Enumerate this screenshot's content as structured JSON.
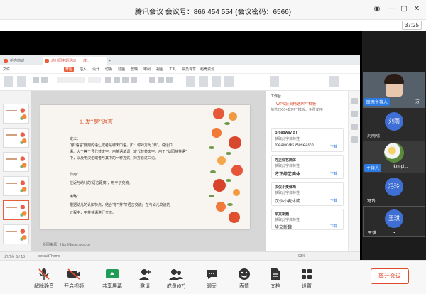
{
  "window": {
    "title": "腾讯会议  会议号：866 454 554  (会议密码：6566)",
    "timer": "37:25"
  },
  "wps": {
    "tabs": [
      "稻壳商城",
      "幼儿园主题活动一一教...",
      "+"
    ],
    "menu": [
      "文件",
      "开始",
      "插入",
      "设计",
      "切换",
      "动画",
      "放映",
      "审阅",
      "视图",
      "工具",
      "会员专享",
      "稻壳资源"
    ],
    "status": [
      "幻灯片 5 / 13",
      "defaultTheme",
      "单击此处添加备注",
      "93%"
    ],
    "thumb_numbers": [
      "1",
      "2",
      "3",
      "4",
      "5"
    ]
  },
  "slide": {
    "title": "1. 发“芽”语言",
    "lines": [
      "定义：",
      "“芽”语言”使用的语汇或者是聊天口语，如：称对方为  “亲”，说话口",
      "语、大于等于号代替文字、用英语单词一定代替某文字。用于  “幼园芽芽语”",
      "中，以及用汉语或者与其中的一种方式，对方看进口语。",
      "",
      "作用：",
      "拉近与幼儿的“语言距离”，用于了交流。",
      "",
      "策略：",
      "根据幼儿的认知特点，结合“芽”“芽”等语言交流；在与幼儿交流的",
      "过程中，用芽芽语进行交流。"
    ],
    "footer": "版图来源：http://docer.wps.cn"
  },
  "panel": {
    "header": "工作台",
    "notice": "WPS会员精选PPT模板",
    "notice_sub": "精选2000+套PPT模板，免费使用",
    "cards": [
      {
        "name": "Broadway BT",
        "desc": "获取此字体特性",
        "sample": "Ideaworks Research",
        "action": "下载"
      },
      {
        "name": "方正综艺简体",
        "desc": "获取此字体特性",
        "sample": "方正综艺简体",
        "action": "下载"
      },
      {
        "name": "汉仪小麦体简",
        "desc": "获取此字体特性",
        "sample": "汉仪小麦体简",
        "action": "下载"
      },
      {
        "name": "华文新魏",
        "desc": "获取此字体特性",
        "sample": "华文新魏",
        "action": "下载"
      }
    ]
  },
  "participants": [
    {
      "name": "联席主持人",
      "tag": "方"
    },
    {
      "name": "刘雨晴",
      "initials": "刘雨"
    },
    {
      "name": "主持人",
      "extra": "Ikm-pi...",
      "host": true
    },
    {
      "name": "冯玲",
      "initials": "冯玲"
    },
    {
      "name": "王琪",
      "initials": "王琪"
    }
  ],
  "toolbar": {
    "items": [
      "解除静音",
      "开启视频",
      "共享屏幕",
      "邀请",
      "成员(67)",
      "聊天",
      "表情",
      "文档",
      "设置"
    ],
    "end": "离开会议"
  },
  "colors": {
    "accent": "#e85d3a",
    "meeting_blue": "#2c7be5",
    "end_red": "#e0492c"
  }
}
